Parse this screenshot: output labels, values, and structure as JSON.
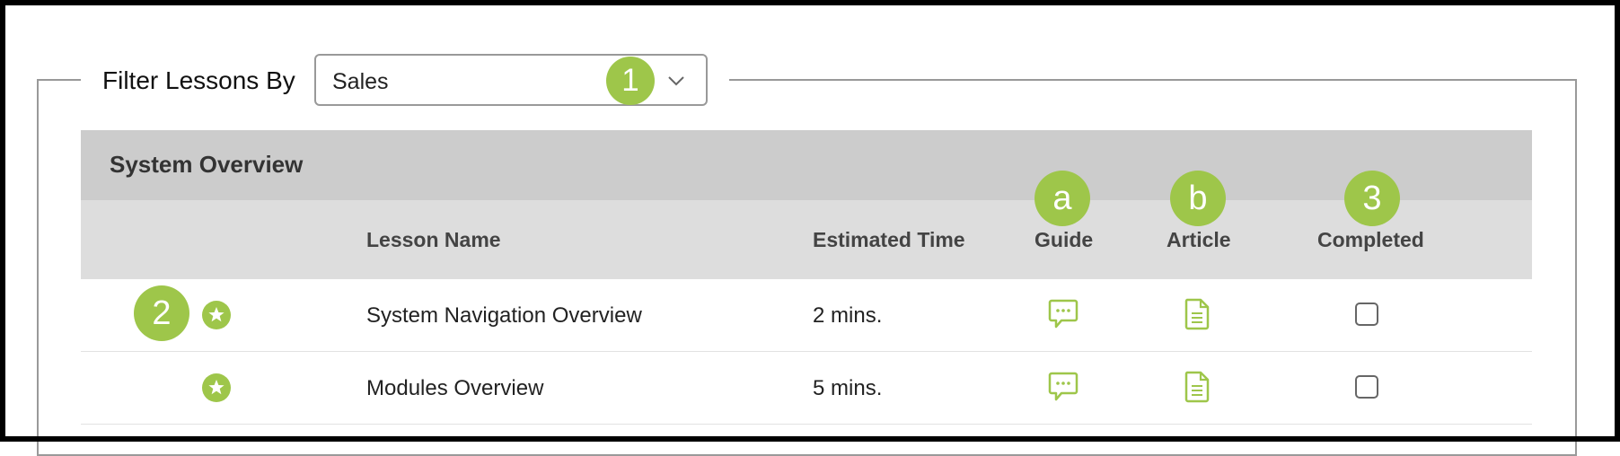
{
  "filter": {
    "label": "Filter Lessons By",
    "selected": "Sales"
  },
  "callouts": {
    "filter": "1",
    "favorite": "2",
    "guide": "a",
    "article": "b",
    "completed": "3"
  },
  "section": {
    "title": "System Overview"
  },
  "columns": {
    "lesson_name": "Lesson Name",
    "estimated_time": "Estimated Time",
    "guide": "Guide",
    "article": "Article",
    "completed": "Completed"
  },
  "lessons": [
    {
      "name": "System Navigation Overview",
      "time": "2 mins.",
      "completed": false
    },
    {
      "name": "Modules Overview",
      "time": "5 mins.",
      "completed": false
    }
  ],
  "colors": {
    "accent": "#9ec64a",
    "header_bg": "#cccccc",
    "subheader_bg": "#dddddd"
  },
  "icons": {
    "favorite": "star-icon",
    "guide": "chat-bubble-icon",
    "article": "document-icon",
    "dropdown": "chevron-down-icon"
  }
}
